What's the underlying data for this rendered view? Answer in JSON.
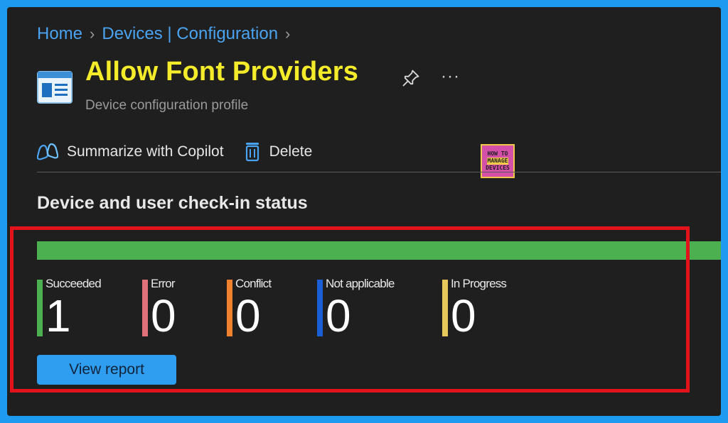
{
  "breadcrumb": {
    "items": [
      "Home",
      "Devices | Configuration"
    ]
  },
  "header": {
    "title": "Allow Font Providers",
    "subtitle": "Device configuration profile",
    "icon": "profile-icon",
    "title_color": "#f4ec2a"
  },
  "toolbar": {
    "copilot_label": "Summarize with Copilot",
    "delete_label": "Delete"
  },
  "watermark": {
    "top": "HOW TO",
    "mid": "MANAGE",
    "bottom": "DEVICES"
  },
  "section": {
    "title": "Device and user check-in status"
  },
  "status_bar_color": "#4caf50",
  "stats": [
    {
      "label": "Succeeded",
      "value": "1",
      "color": "#4caf50"
    },
    {
      "label": "Error",
      "value": "0",
      "color": "#e0707a"
    },
    {
      "label": "Conflict",
      "value": "0",
      "color": "#f0822f"
    },
    {
      "label": "Not applicable",
      "value": "0",
      "color": "#1a5fd6"
    },
    {
      "label": "In Progress",
      "value": "0",
      "color": "#e6c85a"
    }
  ],
  "view_report_label": "View report",
  "highlight_color": "#e3131c"
}
